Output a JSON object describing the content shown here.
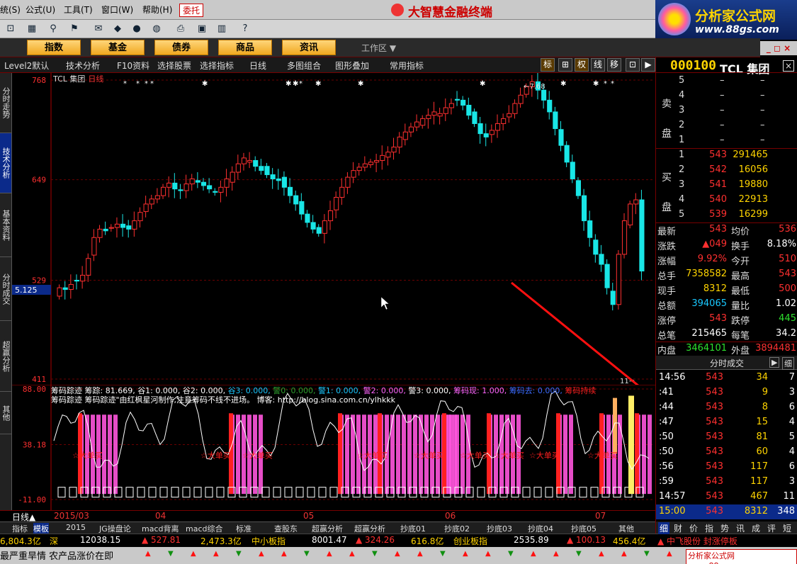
{
  "menu": {
    "items": [
      "统(S)",
      "公式(U)",
      "工具(T)",
      "窗口(W)",
      "帮助(H)"
    ],
    "weituo": "委托"
  },
  "app_title": "大智慧金融终端",
  "brand": {
    "title": "分析家公式网",
    "url": "www.88gs.com"
  },
  "toolbar_icons": [
    "connect-icon",
    "grid-icon",
    "binoculars-icon",
    "alarm-icon",
    "news-icon",
    "diamond-icon",
    "stop-icon",
    "globe-icon",
    "print-icon",
    "window-icon",
    "books-icon",
    "help-cursor-icon"
  ],
  "nav": {
    "buttons": [
      "指数",
      "基金",
      "债券",
      "商品",
      "资讯"
    ],
    "workspace": "工作区",
    "win_controls": "_ ◻ ×"
  },
  "funcbar": {
    "items": [
      "Level2默认",
      "技术分析",
      "F10资料",
      "选择股票",
      "选择指标",
      "日线",
      "多图组合",
      "图形叠加",
      "常用指标"
    ],
    "right_buttons": [
      "标",
      "⊞",
      "权",
      "线",
      "移",
      "⊡",
      "▶"
    ]
  },
  "vtabs": [
    "分时走势",
    "技术分析",
    "基本资料",
    "分时成交",
    "超赢分析",
    "其他"
  ],
  "main_chart": {
    "stock_name": "TCL 集团",
    "period": "日线",
    "y_labels": [
      {
        "v": 768,
        "t": "768"
      },
      {
        "v": 649,
        "t": "649"
      },
      {
        "v": 529,
        "t": "529"
      },
      {
        "v": 411,
        "t": "411"
      }
    ],
    "cursor_label": "5.125",
    "high_marker": "7.68",
    "low_marker": "11"
  },
  "indicator": {
    "line1": [
      {
        "t": "筹码踪迹  ",
        "c": "#ffffff"
      },
      {
        "t": "筹踪: 81.669, ",
        "c": "#ffffff"
      },
      {
        "t": "谷1: 0.000, ",
        "c": "#ffffff"
      },
      {
        "t": "谷2: 0.000, ",
        "c": "#ffffff"
      },
      {
        "t": "谷3: 0.000, ",
        "c": "#19c8ff"
      },
      {
        "t": "警0: 0.000, ",
        "c": "#2ea02e"
      },
      {
        "t": "警1: 0.000, ",
        "c": "#19c8ff"
      },
      {
        "t": "警2: 0.000, ",
        "c": "#ff66ff"
      },
      {
        "t": "警3: 0.000, ",
        "c": "#ffffff"
      },
      {
        "t": "筹码现: 1.000, ",
        "c": "#ff66ff"
      },
      {
        "t": "筹码去: 0.000, ",
        "c": "#3c6cff"
      },
      {
        "t": "筹码持续",
        "c": "#ff2020"
      }
    ],
    "line2": "筹码踪迹   筹码踪迹\"由红枫星河制作,注意筹码不线不进场。 博客: http://blog.sina.com.cn/ylhkkk",
    "y_labels": [
      {
        "v": 88,
        "t": "88.00"
      },
      {
        "v": 38.18,
        "t": "38.18"
      },
      {
        "v": -11,
        "t": "-11.00"
      }
    ],
    "buy_label": "☆大单买"
  },
  "datebar": {
    "label": "日线▲",
    "periods": [
      "2015/03",
      "04",
      "05",
      "06",
      "07"
    ]
  },
  "tabs": [
    "指标",
    "模板",
    "2015",
    "JG操盘论",
    "macd背离",
    "macd综合",
    "标准",
    "查股东",
    "超赢分析",
    "超赢分析",
    "抄底01",
    "抄底02",
    "抄底03",
    "抄底04",
    "抄底05",
    "其他"
  ],
  "ticker": [
    {
      "t": "6,804.3亿",
      "c": "#ffd400"
    },
    {
      "t": "深",
      "c": "#ffd400"
    },
    {
      "t": "12038.15",
      "c": "#ffffff"
    },
    {
      "t": "▲ 527.81",
      "c": "#ff3030"
    },
    {
      "t": "2,473.3亿",
      "c": "#ffd400"
    },
    {
      "t": "中小板指",
      "c": "#ffd400"
    },
    {
      "t": "8001.47",
      "c": "#ffffff"
    },
    {
      "t": "▲ 324.26",
      "c": "#ff3030"
    },
    {
      "t": "616.8亿",
      "c": "#ffd400"
    },
    {
      "t": "创业板指",
      "c": "#ffd400"
    },
    {
      "t": "2535.89",
      "c": "#ffffff"
    },
    {
      "t": "▲ 100.13",
      "c": "#ff3030"
    },
    {
      "t": "456.4亿",
      "c": "#ffd400"
    },
    {
      "t": "▲ 中飞股份 封涨停板",
      "c": "#ff3030"
    }
  ],
  "news": "最严重旱情 农产品涨价在即",
  "watermark": "分析家公式网 www.88gs.com",
  "quote": {
    "code": "000100",
    "name": "TCL 集团",
    "sell_side": "卖盘",
    "buy_side": "买盘",
    "sell": [
      {
        "lvl": "5",
        "price": "–",
        "vol": "–"
      },
      {
        "lvl": "4",
        "price": "–",
        "vol": "–"
      },
      {
        "lvl": "3",
        "price": "–",
        "vol": "–"
      },
      {
        "lvl": "2",
        "price": "–",
        "vol": "–"
      },
      {
        "lvl": "1",
        "price": "–",
        "vol": "–"
      }
    ],
    "buy": [
      {
        "lvl": "1",
        "price": "543",
        "vol": "291465"
      },
      {
        "lvl": "2",
        "price": "542",
        "vol": "16056"
      },
      {
        "lvl": "3",
        "price": "541",
        "vol": "19880"
      },
      {
        "lvl": "4",
        "price": "540",
        "vol": "22913"
      },
      {
        "lvl": "5",
        "price": "539",
        "vol": "16299"
      }
    ],
    "stats": [
      {
        "l1": "最新",
        "v1": "543",
        "c1": "#ff3030",
        "l2": "均价",
        "v2": "536",
        "c2": "#ff3030"
      },
      {
        "l1": "涨跌",
        "v1": "▲049",
        "c1": "#ff3030",
        "l2": "换手",
        "v2": "8.18%",
        "c2": "#ffffff"
      },
      {
        "l1": "涨幅",
        "v1": "9.92%",
        "c1": "#ff3030",
        "l2": "今开",
        "v2": "510",
        "c2": "#ff3030"
      },
      {
        "l1": "总手",
        "v1": "7358582",
        "c1": "#ffd400",
        "l2": "最高",
        "v2": "543",
        "c2": "#ff3030"
      },
      {
        "l1": "现手",
        "v1": "8312",
        "c1": "#ffd400",
        "l2": "最低",
        "v2": "500",
        "c2": "#ff3030"
      },
      {
        "l1": "总额",
        "v1": "394065",
        "c1": "#19c8ff",
        "l2": "量比",
        "v2": "1.02",
        "c2": "#ffffff"
      },
      {
        "l1": "涨停",
        "v1": "543",
        "c1": "#ff3030",
        "l2": "跌停",
        "v2": "445",
        "c2": "#2ee02e"
      },
      {
        "l1": "总笔",
        "v1": "215465",
        "c1": "#ffffff",
        "l2": "每笔",
        "v2": "34.2",
        "c2": "#ffffff"
      },
      {
        "l1": "内盘",
        "v1": "3464101",
        "c1": "#2ee02e",
        "l2": "外盘",
        "v2": "3894481",
        "c2": "#ff3030"
      }
    ]
  },
  "ticks_panel": {
    "title": "分时成交",
    "btn_prev": "▶",
    "btn_detail": "细"
  },
  "ticks": [
    {
      "time": "14:56",
      "price": "543",
      "vol": "34",
      "n": "7"
    },
    {
      "time": ":41",
      "price": "543",
      "vol": "9",
      "n": "3"
    },
    {
      "time": ":44",
      "price": "543",
      "vol": "8",
      "n": "6"
    },
    {
      "time": ":47",
      "price": "543",
      "vol": "15",
      "n": "4"
    },
    {
      "time": ":50",
      "price": "543",
      "vol": "81",
      "n": "5"
    },
    {
      "time": ":50",
      "price": "543",
      "vol": "60",
      "n": "4"
    },
    {
      "time": ":56",
      "price": "543",
      "vol": "117",
      "n": "6"
    },
    {
      "time": ":59",
      "price": "543",
      "vol": "117",
      "n": "3"
    },
    {
      "time": "14:57",
      "price": "543",
      "vol": "467",
      "n": "11"
    },
    {
      "time": "15:00",
      "price": "543",
      "vol": "8312",
      "n": "348"
    }
  ],
  "rtabs": [
    "细",
    "财",
    "价",
    "指",
    "势",
    "讯",
    "成",
    "评",
    "短"
  ],
  "colors": {
    "up": "#ff3030",
    "down": "#19e6e6",
    "grid": "#7a0000",
    "accent": "#ffd400"
  }
}
